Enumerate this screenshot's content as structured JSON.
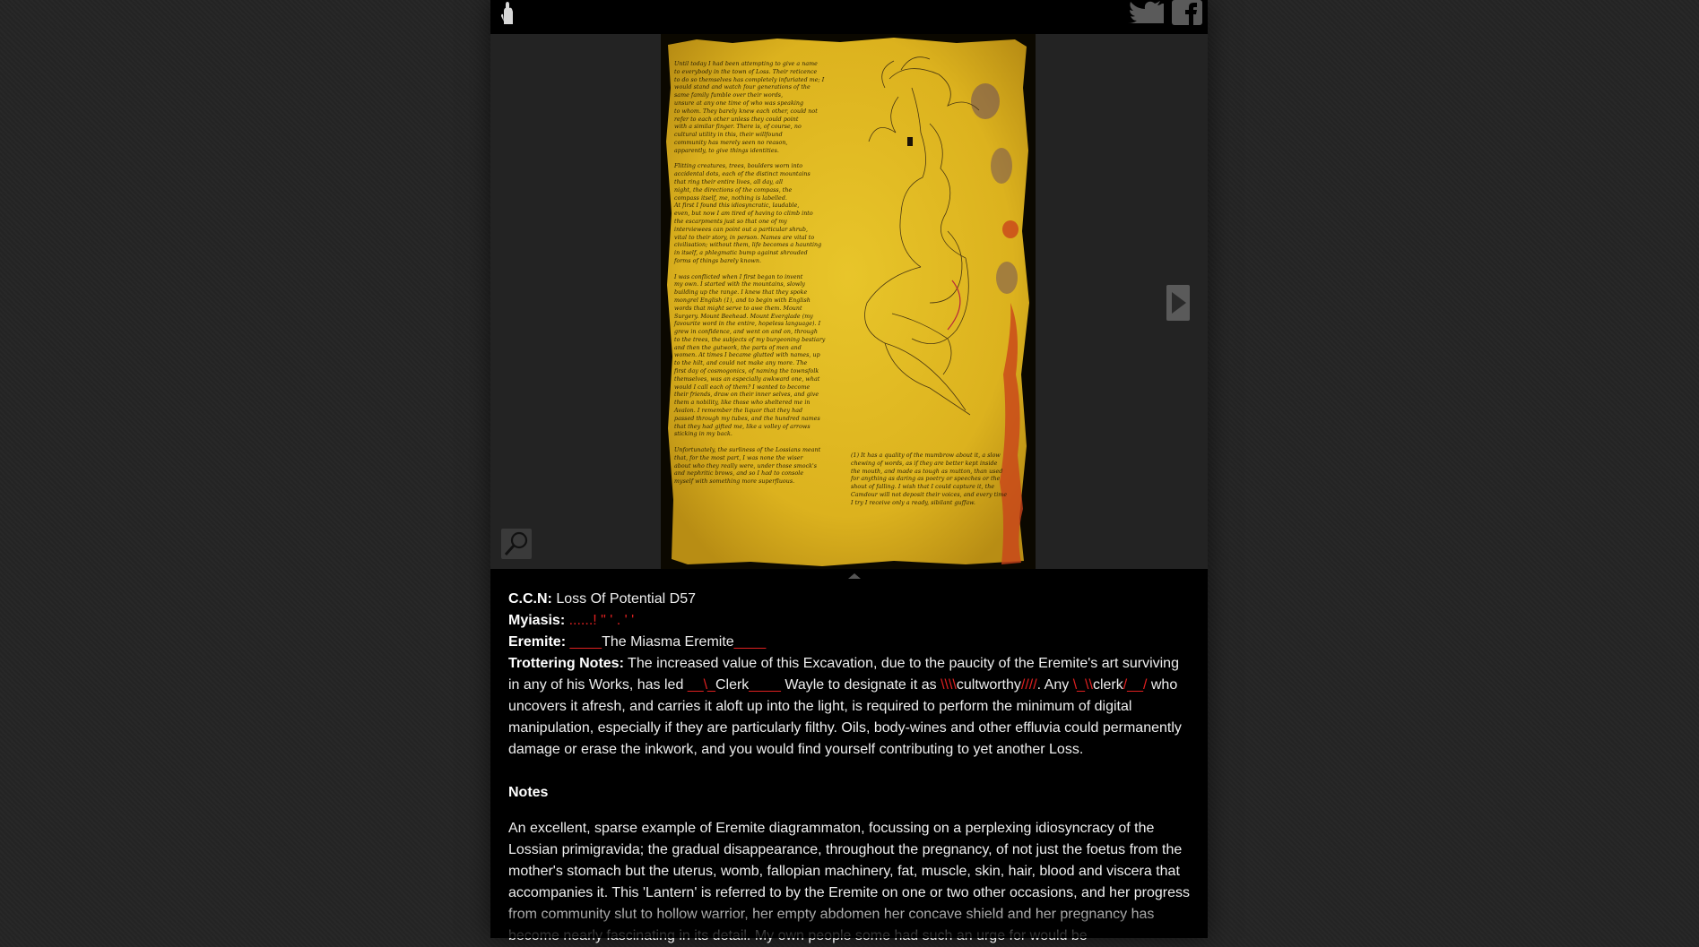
{
  "header": {
    "logo_icon": "hand-logo-icon",
    "twitter_icon": "twitter-icon",
    "facebook_icon": "facebook-icon"
  },
  "viewer": {
    "page_left_text": "Until today I had been attempting to give a name\nto everybody in the town of Loss. Their reticence\nto do so themselves has completely infuriated me; I\nwould stand and watch four generations of the\nsame family fumble over their words,\nunsure at any one time of who was speaking\nto whom. They barely knew each other, could not\nrefer to each other unless they could point\nwith a similar finger. There is, of course, no\ncultural utility in this, their willfound\ncommunity has merely seen no reason,\napparently, to give things identities.\n\nFlitting creatures, trees, boulders worn into\naccidental dots, each of the distinct mountains\nthat ring their entire lives, all day, all\nnight, the directions of the compass, the\ncompass itself, me, nothing is labelled.\nAt first I found this idiosyncratic, laudable,\neven, but now I am tired of having to climb into\nthe escarpments just so that one of my\ninterviewees can point out a particular shrub,\nvital to their story, in person. Names are vital to\ncivilisation; without them, life becomes a haunting\nin itself, a phlegmatic bump against shrouded\nforms of things barely known.\n\nI was conflicted when I first began to invent\nmy own. I started with the mountains, slowly\nbuilding up the range. I knew that they spoke\nmongrel English (1), and to begin with English\nwords that might serve to awe them. Mount\nSurgery. Mount Beehead. Mount Everglade (my\nfavourite word in the entire, hopeless language). I\ngrew in confidence, and went on and on, through\nto the trees, the subjects of my burgeoning bestiary\nand then the gutwork, the parts of men and\nwomen. At times I became glutted with names, up\nto the hilt, and could not make any more. The\nfirst day of cosmogonics, of naming the townsfolk\nthemselves, was an especially awkward one, what\nwould I call each of them? I wanted to become\ntheir friends, draw on their inner selves, and give\nthem a nobility, like those who sheltered me in\nAvalon. I remember the liquor that they had\npassed through my tubes, and the hundred names\nthat they had gifted me, like a volley of arrows\nsticking in my back.\n\nUnfortunately, the surliness of the Lossians meant\nthat, for the most part, I was none the wiser\nabout who they really were, under those smock's\nand nephritic brows, and so I had to console\nmyself with something more superfluous.",
    "page_right_text": "(1) It has a quality of the mumbrow about it, a slow\nchewing of words, as if they are better kept inside\nthe mouth, and made as tough as mutton, than used\nfor anything as daring as poetry or speeches or the\nshout of falling. I wish that I could capture it, the\nCamdour will not deposit their voices, and every time\nI try I receive only a ready, sibilant guffaw.",
    "next_icon": "play-arrow-icon",
    "zoom_icon": "magnifier-icon",
    "page_color": "#e2b51e"
  },
  "info": {
    "ccn_label": "C.C.N:",
    "ccn_value": "Loss Of Potential D57",
    "myiasis_label": "Myiasis:",
    "myiasis_value": "......! \" ' . ' '",
    "eremite_label": "Eremite:",
    "eremite_pre": "____",
    "eremite_value": "The Miasma Eremite",
    "eremite_post": "____",
    "trottering_label": "Trottering Notes:",
    "trottering_1": "The increased value of this Excavation, due to the paucity of the Eremite's art surviving in any of his Works, has led",
    "clerk_pre": "__\\_",
    "clerk_name": "Clerk",
    "clerk_post": "____",
    "trottering_2": "Wayle to designate it as",
    "cultworthy_pre": "\\\\\\\\",
    "cultworthy": "cultworthy",
    "cultworthy_post": "////",
    "trottering_3": ". Any",
    "clerk2_pre": "\\_\\\\",
    "clerk2": "clerk",
    "clerk2_post": "/__/",
    "trottering_4": "who uncovers it afresh, and carries it aloft up into the light, is required to perform the minimum of digital manipulation, especially if they are particularly filthy. Oils, body-wines and other effluvia could permanently damage or erase the inkwork, and you would find yourself contributing to yet another Loss.",
    "notes_heading": "Notes",
    "notes_body": "An excellent, sparse example of Eremite diagrammaton, focussing on a perplexing idiosyncracy of the Lossian primigravida; the gradual disappearance, throughout the pregnancy, of not just the foetus from the mother's stomach but the uterus, womb, fallopian machinery, fat, muscle, skin, hair, blood and viscera that accompanies it. This 'Lantern' is referred to by the Eremite on one or two other occasions, and her progress from community slut to hollow warrior, her empty abdomen her concave shield and her pregnancy has become nearly fascinating in its detail. My own people some had such an urge for would be"
  }
}
